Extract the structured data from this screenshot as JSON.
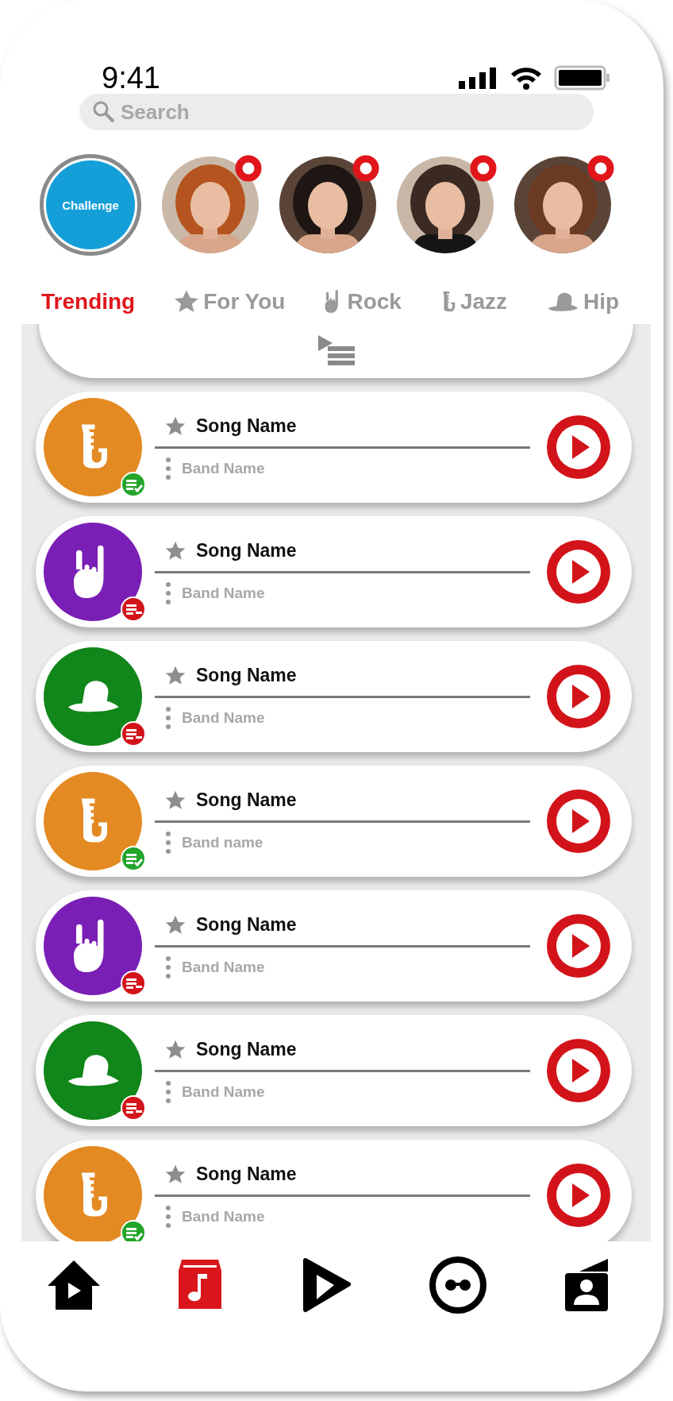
{
  "status_bar": {
    "time": "9:41"
  },
  "search": {
    "placeholder": "Search"
  },
  "stories": [
    {
      "kind": "challenge",
      "label": "Challenge"
    },
    {
      "kind": "person",
      "new": true
    },
    {
      "kind": "person",
      "new": true
    },
    {
      "kind": "person",
      "new": true
    },
    {
      "kind": "person",
      "new": true
    }
  ],
  "tabs": [
    {
      "kind": "trending",
      "label": "Trending",
      "selected": true
    },
    {
      "kind": "star",
      "label": "For You",
      "selected": false
    },
    {
      "kind": "rock",
      "label": "Rock",
      "selected": false
    },
    {
      "kind": "jazz",
      "label": "Jazz",
      "selected": false
    },
    {
      "kind": "hiphop",
      "label": "Hip",
      "selected": false
    }
  ],
  "songs": [
    {
      "kind": "jazz",
      "color": "#e48a22",
      "title": "Song Name",
      "band": "Band Name",
      "added": true
    },
    {
      "kind": "rock",
      "color": "#7a1fb5",
      "title": "Song Name",
      "band": "Band Name",
      "added": false
    },
    {
      "kind": "hiphop",
      "color": "#11861a",
      "title": "Song Name",
      "band": "Band Name",
      "added": false
    },
    {
      "kind": "jazz",
      "color": "#e48a22",
      "title": "Song Name",
      "band": "Band name",
      "added": true
    },
    {
      "kind": "rock",
      "color": "#7a1fb5",
      "title": "Song Name",
      "band": "Band Name",
      "added": false
    },
    {
      "kind": "hiphop",
      "color": "#11861a",
      "title": "Song Name",
      "band": "Band Name",
      "added": false
    },
    {
      "kind": "jazz",
      "color": "#e48a22",
      "title": "Song Name",
      "band": "Band Name",
      "added": true
    }
  ],
  "nav": [
    {
      "kind": "home",
      "selected": false
    },
    {
      "kind": "music",
      "selected": true
    },
    {
      "kind": "play",
      "selected": false
    },
    {
      "kind": "face",
      "selected": false
    },
    {
      "kind": "profile",
      "selected": false
    }
  ]
}
